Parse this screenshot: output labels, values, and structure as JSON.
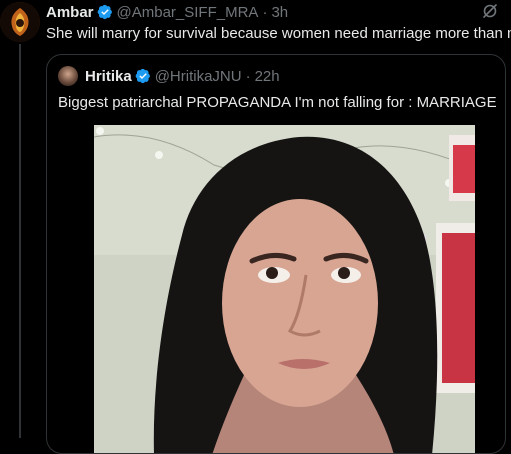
{
  "tweet": {
    "author_name": "Ambar",
    "author_handle": "@Ambar_SIFF_MRA",
    "separator": "·",
    "time": "3h",
    "text": "She will marry for survival because women need marriage more than men",
    "avatar_icon": "avatar-image",
    "verified_icon": "verified-badge-icon",
    "grok_icon": "grok-icon"
  },
  "quote": {
    "author_name": "Hritika",
    "author_handle": "@HritikaJNU",
    "separator": "·",
    "time": "22h",
    "text": "Biggest patriarchal PROPAGANDA I'm not falling for : MARRIAGE",
    "media": "photo"
  },
  "colors": {
    "background": "#000000",
    "text": "#e7e9ea",
    "muted": "#71767b",
    "border": "#2f3336",
    "verified": "#1d9bf0"
  }
}
